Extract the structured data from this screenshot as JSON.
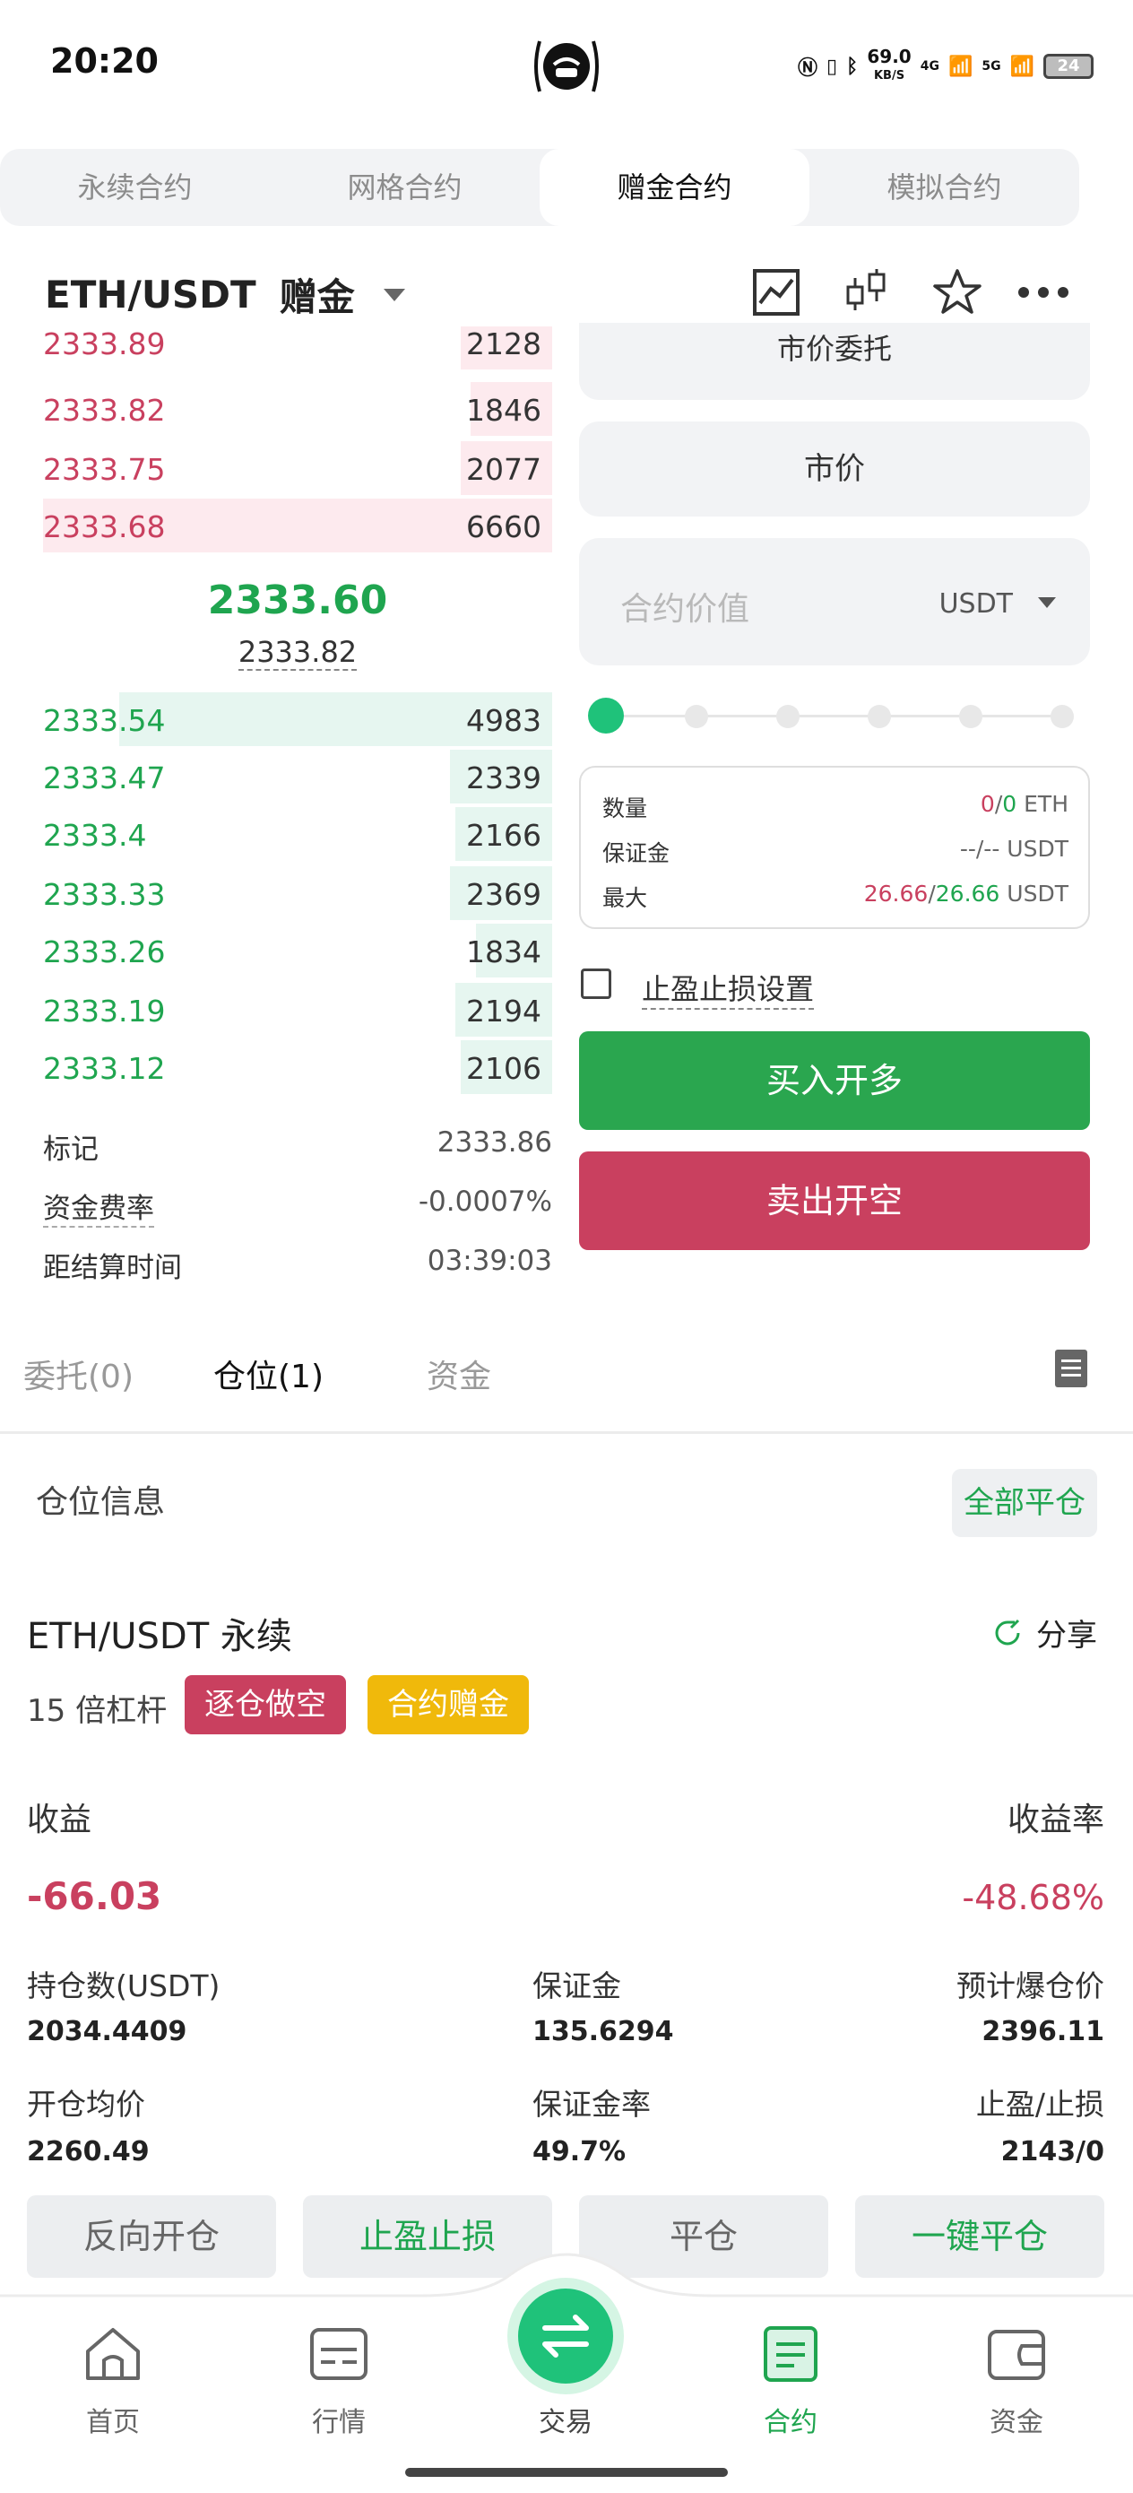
{
  "status_bar": {
    "time": "20:20",
    "speed": "69.0",
    "speed_unit": "KB/S",
    "net": "4G",
    "net2": "5G",
    "battery": "24"
  },
  "top_tabs": [
    {
      "label": "永续合约",
      "active": false
    },
    {
      "label": "网格合约",
      "active": false
    },
    {
      "label": "赠金合约",
      "active": true
    },
    {
      "label": "模拟合约",
      "active": false
    }
  ],
  "header": {
    "pair": "ETH/USDT",
    "type": "赠金"
  },
  "orderbook": {
    "asks": [
      {
        "price": "2333.89",
        "qty": "2128",
        "depth": 0.18
      },
      {
        "price": "2333.82",
        "qty": "1846",
        "depth": 0.16
      },
      {
        "price": "2333.75",
        "qty": "2077",
        "depth": 0.18
      },
      {
        "price": "2333.68",
        "qty": "6660",
        "depth": 1.0
      }
    ],
    "last_price": "2333.60",
    "mark_under": "2333.82",
    "bids": [
      {
        "price": "2333.54",
        "qty": "4983",
        "depth": 0.85
      },
      {
        "price": "2333.47",
        "qty": "2339",
        "depth": 0.2
      },
      {
        "price": "2333.4",
        "qty": "2166",
        "depth": 0.19
      },
      {
        "price": "2333.33",
        "qty": "2369",
        "depth": 0.2
      },
      {
        "price": "2333.26",
        "qty": "1834",
        "depth": 0.15
      },
      {
        "price": "2333.19",
        "qty": "2194",
        "depth": 0.19
      },
      {
        "price": "2333.12",
        "qty": "2106",
        "depth": 0.18
      }
    ],
    "mark_label": "标记",
    "mark_value": "2333.86",
    "funding_label": "资金费率",
    "funding_value": "-0.0007%",
    "settle_label": "距结算时间",
    "settle_value": "03:39:03"
  },
  "order_form": {
    "order_type": "市价委托",
    "price_mode": "市价",
    "value_placeholder": "合约价值",
    "value_unit": "USDT",
    "slider_percent": 0,
    "qty_label": "数量",
    "qty_a": "0",
    "qty_b": "0",
    "qty_unit": "ETH",
    "margin_label": "保证金",
    "margin_value": "--/--",
    "margin_unit": "USDT",
    "max_label": "最大",
    "max_a": "26.66",
    "max_b": "26.66",
    "max_unit": "USDT",
    "tpsl_label": "止盈止损设置",
    "buy_label": "买入开多",
    "sell_label": "卖出开空"
  },
  "lower_tabs": [
    {
      "label": "委托(0)",
      "active": false
    },
    {
      "label": "仓位(1)",
      "active": true
    },
    {
      "label": "资金",
      "active": false
    }
  ],
  "position": {
    "section_title": "仓位信息",
    "close_all": "全部平仓",
    "pair": "ETH/USDT 永续",
    "share": "分享",
    "leverage": "15 倍杠杆",
    "badge_side": "逐仓做空",
    "badge_bonus": "合约赠金",
    "pnl_label": "收益",
    "pnl_value": "-66.03",
    "roe_label": "收益率",
    "roe_value": "-48.68%",
    "size_label": "持仓数(USDT)",
    "size_value": "2034.4409",
    "margin_label": "保证金",
    "margin_value": "135.6294",
    "liq_label": "预计爆仓价",
    "liq_value": "2396.11",
    "entry_label": "开仓均价",
    "entry_value": "2260.49",
    "margin_rate_label": "保证金率",
    "margin_rate_value": "49.7%",
    "tpsl_label": "止盈/止损",
    "tpsl_value": "2143/0",
    "actions": [
      "反向开仓",
      "止盈止损",
      "平仓",
      "一键平仓"
    ]
  },
  "bottom_nav": [
    {
      "label": "首页",
      "icon": "home-icon"
    },
    {
      "label": "行情",
      "icon": "market-icon"
    },
    {
      "label": "交易",
      "icon": "swap-icon"
    },
    {
      "label": "合约",
      "icon": "contract-icon"
    },
    {
      "label": "资金",
      "icon": "wallet-icon"
    }
  ],
  "colors": {
    "green": "#1fa54f",
    "red": "#c9405f",
    "bonus": "#f0b90b"
  }
}
